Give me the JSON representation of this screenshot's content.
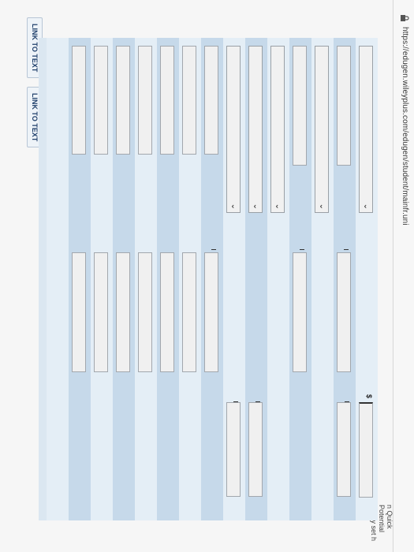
{
  "browser": {
    "url": "https://edugen.wileyplus.com/edugen/student/mainfr.uni"
  },
  "page": {
    "link_to_text_1": "LINK TO TEXT",
    "link_to_text_2": "LINK TO TEXT",
    "currency_symbol": "$",
    "cutoff_text": "n Quick Potential Policy set h"
  },
  "colors": {
    "row_dark": "#c6d9ea",
    "row_light": "#e4eef6",
    "link_text": "#1f3f6b"
  }
}
